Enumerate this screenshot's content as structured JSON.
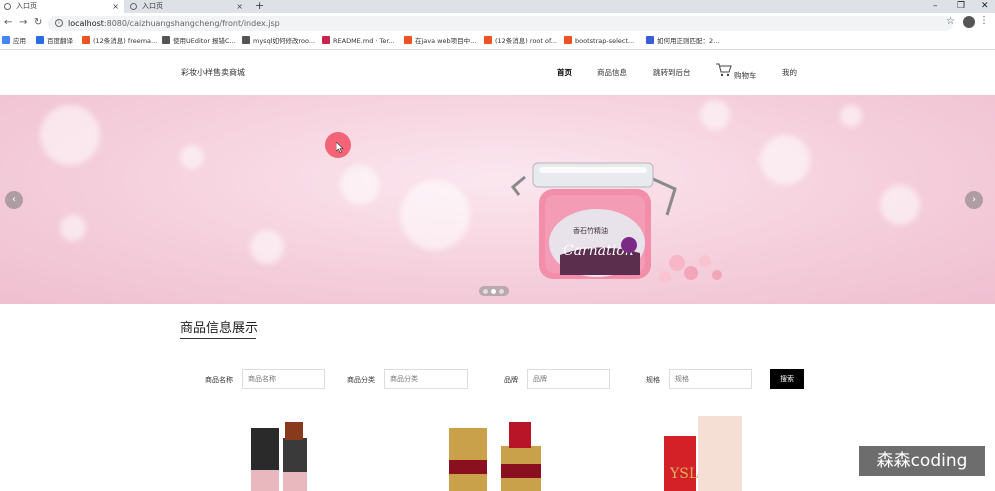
{
  "browser": {
    "tabs": [
      {
        "title": "入口页"
      },
      {
        "title": "入口页"
      }
    ],
    "url_host": "localhost",
    "url_path": ":8080/caizhuangshangcheng/front/index.jsp",
    "bookmarks": [
      {
        "label": "应用",
        "color": "#4285f4"
      },
      {
        "label": "百度翻译",
        "color": "#2a6ce6"
      },
      {
        "label": "(12条消息) freema...",
        "color": "#e8531f"
      },
      {
        "label": "使用UEditor 报错C...",
        "color": "#555555"
      },
      {
        "label": "mysql如何修改roo...",
        "color": "#555555"
      },
      {
        "label": "README.md · Ter...",
        "color": "#c7254e"
      },
      {
        "label": "在java web项目中...",
        "color": "#e8531f"
      },
      {
        "label": "(12条消息) root of...",
        "color": "#e8531f"
      },
      {
        "label": "bootstrap-select...",
        "color": "#e8531f"
      },
      {
        "label": "如何用正则匹配：2...",
        "color": "#3b5bdb"
      }
    ]
  },
  "site": {
    "logo": "彩妆小样售卖商城",
    "nav": [
      "首页",
      "商品信息",
      "跳转到后台",
      "购物车",
      "我的"
    ]
  },
  "banner": {
    "product_brand": "Carnation",
    "product_text": "香石竹精油",
    "prev_arrow": "‹",
    "next_arrow": "›"
  },
  "section": {
    "title": "商品信息展示"
  },
  "search": {
    "name_label": "商品名称",
    "name_placeholder": "商品名称",
    "category_label": "商品分类",
    "category_placeholder": "商品分类",
    "brand_label": "品牌",
    "brand_placeholder": "品牌",
    "spec_label": "规格",
    "spec_placeholder": "规格",
    "button": "搜索"
  },
  "watermark": "森森coding",
  "colors": {
    "banner_pink": "#f5cfdc",
    "button_black": "#000000",
    "cursor_highlight": "#f0465a"
  }
}
